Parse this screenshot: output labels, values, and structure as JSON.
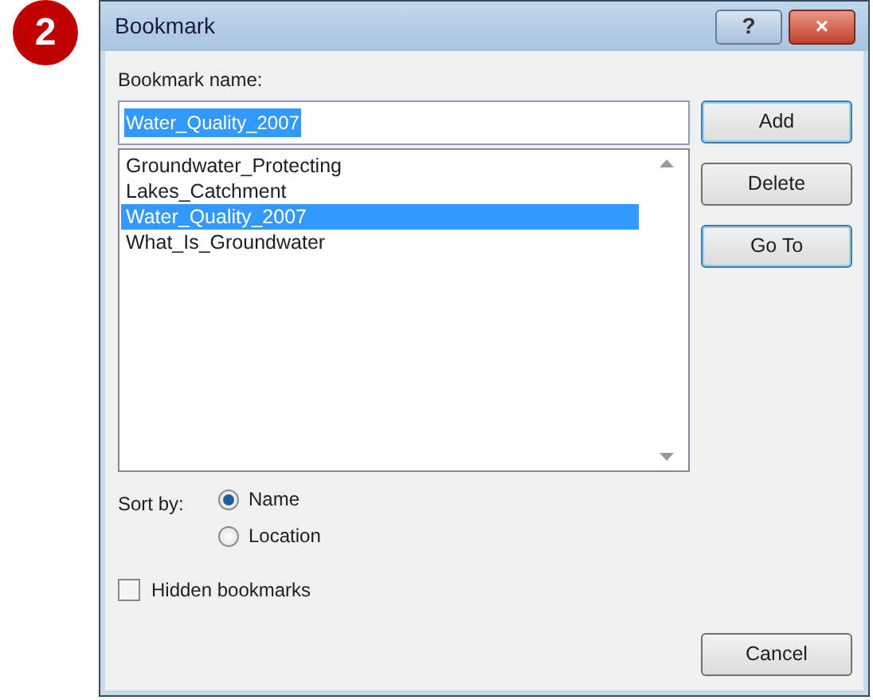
{
  "step_badge": "2",
  "window": {
    "title": "Bookmark",
    "help_button": "?",
    "close_button": "×"
  },
  "name_label": "Bookmark name:",
  "name_field": {
    "value": "Water_Quality_2007",
    "selected": true
  },
  "bookmarks": [
    {
      "label": "Groundwater_Protecting",
      "selected": false
    },
    {
      "label": "Lakes_Catchment",
      "selected": false
    },
    {
      "label": "Water_Quality_2007",
      "selected": true
    },
    {
      "label": "What_Is_Groundwater",
      "selected": false
    }
  ],
  "buttons": [
    {
      "label": "Add",
      "default": true
    },
    {
      "label": "Delete",
      "default": false
    },
    {
      "label": "Go To",
      "default": true
    }
  ],
  "sort_label": "Sort by:",
  "sort_options": [
    {
      "label": "Name",
      "selected": true
    },
    {
      "label": "Location",
      "selected": false
    }
  ],
  "hidden_bookmarks": {
    "label": "Hidden bookmarks",
    "checked": false
  },
  "cancel_button": "Cancel"
}
